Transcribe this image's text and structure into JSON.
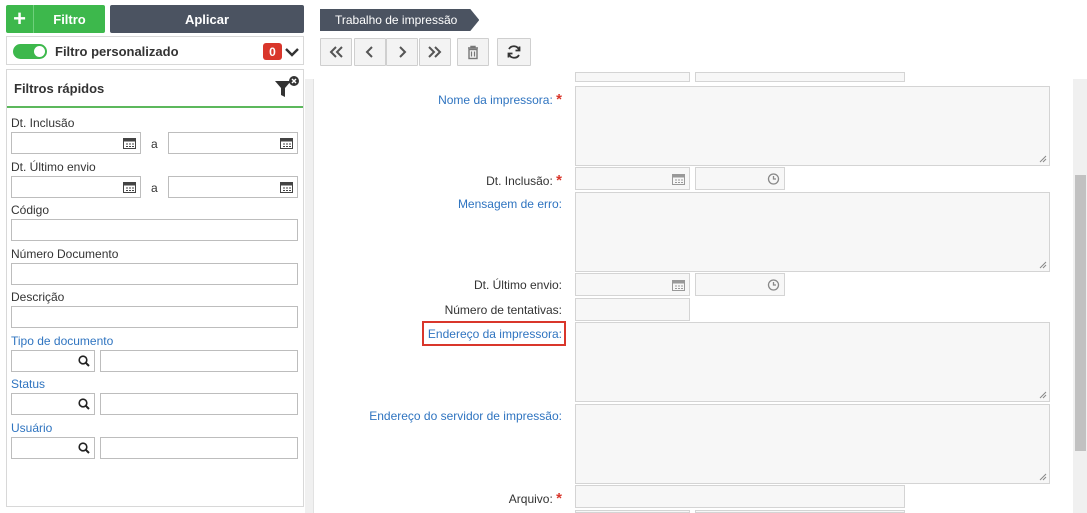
{
  "left": {
    "filter_button": "Filtro",
    "apply_button": "Aplicar",
    "custom_filter_label": "Filtro personalizado",
    "custom_filter_count": "0",
    "quick_filters_title": "Filtros rápidos",
    "range_sep": "a",
    "fields": {
      "dt_inclusao": "Dt. Inclusão",
      "dt_ultimo_envio": "Dt. Último envio",
      "codigo": "Código",
      "numero_documento": "Número Documento",
      "descricao": "Descrição",
      "tipo_documento": "Tipo de documento",
      "status": "Status",
      "usuario": "Usuário"
    }
  },
  "header": {
    "breadcrumb": "Trabalho de impressão"
  },
  "form": {
    "nome_impressora": "Nome da impressora:",
    "dt_inclusao": "Dt. Inclusão:",
    "mensagem_erro": "Mensagem de erro:",
    "dt_ultimo_envio": "Dt. Último envio:",
    "numero_tentativas": "Número de tentativas:",
    "endereco_impressora": "Endereço da impressora:",
    "endereco_servidor": "Endereço do servidor de impressão:",
    "arquivo": "Arquivo:",
    "required_mark": "*"
  },
  "colors": {
    "accent_green": "#3db84c",
    "dark_button": "#4b5361",
    "link_blue": "#2f74c0",
    "required_red": "#d9362b"
  }
}
